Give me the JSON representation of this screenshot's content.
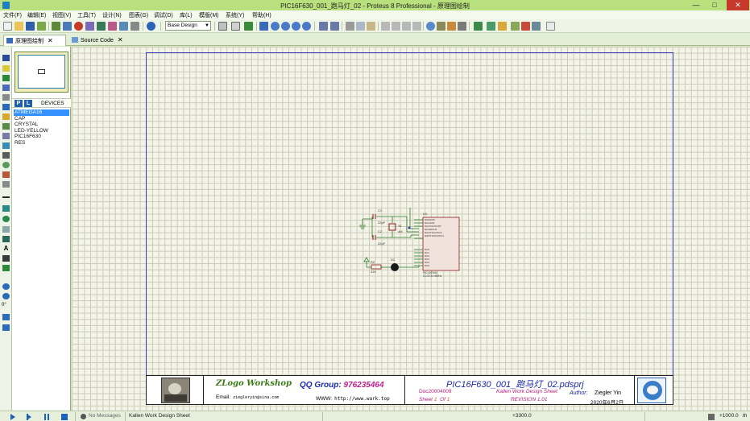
{
  "window": {
    "title": "PIC16F630_001_跑马灯_02 - Proteus 8 Professional - 原理图绘制",
    "minimize": "—",
    "maximize": "□",
    "close": "✕"
  },
  "menu": [
    "文件(F)",
    "编辑(E)",
    "视图(V)",
    "工具(T)",
    "设计(N)",
    "图表(G)",
    "调试(D)",
    "库(L)",
    "模版(M)",
    "系统(Y)",
    "帮助(H)"
  ],
  "toolbar": {
    "design_select": "Base Design"
  },
  "tabs": [
    {
      "label": "原理图绘制",
      "active": true
    },
    {
      "label": "Source Code",
      "active": false
    }
  ],
  "panel": {
    "p_button": "P",
    "l_button": "L",
    "header": "DEVICES",
    "devices": [
      "ATMEGA16",
      "CAP",
      "CRYSTAL",
      "LED-YELLOW",
      "PIC16F630",
      "RES"
    ],
    "selected_index": 0
  },
  "left_tools": {
    "rotation": "0°"
  },
  "schematic": {
    "c1": "C1",
    "c1_val": "22pF",
    "c2": "C2",
    "c2_val": "22pF",
    "x1": "X1",
    "x1_val": "4M",
    "u1": "U1",
    "r2": "R2",
    "r2_val": "220",
    "d1": "D1",
    "chip_name": "PIC16F630",
    "chip_clock": "CLOCK=4MHz",
    "pins_left": [
      "RA0/AN0",
      "RA1/AN1",
      "RA2/T0CKI/INT",
      "RA3/MCLR",
      "RA4/T1G/OSC2",
      "RA5/T1CKI/OSC1"
    ],
    "pins_right": [
      "RC0",
      "RC1",
      "RC2",
      "RC3",
      "RC4",
      "RC5"
    ]
  },
  "title_block": {
    "logo": "ZLogo Workshop",
    "qq_label": "QQ Group:",
    "qq_number": "976235464",
    "email_label": "Email:",
    "email": "ziegleryin@sina.com",
    "www_label": "WWW:",
    "www": "http://www.wark.top",
    "project": "PIC16F630_001_跑马灯_02.pdsprj",
    "doc": "Doc20004009",
    "kallen": "Kallen Work Design Sheet",
    "author_label": "Author:",
    "author": "Ziegler Yin",
    "sheet_label": "Sheet",
    "sheet_num": "1",
    "of_label": "Of",
    "of_num": "1",
    "revision": "REVISION 1.01",
    "date": "2020年6月2日"
  },
  "statusbar": {
    "messages": "No Messages",
    "sheet_name": "Kallen Work Design Sheet",
    "coord_x": "+3300.0",
    "coord_y": "+1000.0",
    "unit": "th"
  },
  "colors": {
    "title_bar": "#b8e07c",
    "canvas": "#f3f3e7",
    "grid": "#c9cbb6",
    "sheet_border": "#3f3fc8",
    "wire": "#2e7d32",
    "component": "#8b1a1a"
  }
}
